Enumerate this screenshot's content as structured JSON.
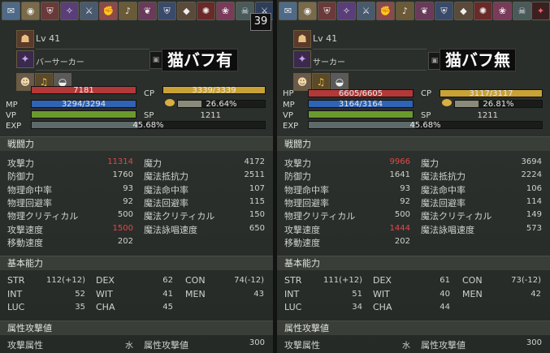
{
  "colors": {
    "hp_bar": "#b33838",
    "mp_bar": "#2e63b5",
    "vp_bar": "#6a9a2e",
    "cp_bar": "#c9a236",
    "exp_bar": "#5e6a6a",
    "highlight_red": "#e24848"
  },
  "left": {
    "buff_count": "39",
    "buffs": [
      {
        "icon": "scroll-icon",
        "glyph": "✉",
        "bg": "#4e6a88"
      },
      {
        "icon": "drum-icon",
        "glyph": "◉",
        "bg": "#7a6a4a"
      },
      {
        "icon": "shield-icon",
        "glyph": "⛨",
        "bg": "#6a3a3a"
      },
      {
        "icon": "magic-icon",
        "glyph": "✧",
        "bg": "#5a3e7a"
      },
      {
        "icon": "blade-icon",
        "glyph": "⚔",
        "bg": "#4a5a6e"
      },
      {
        "icon": "fist-icon",
        "glyph": "✊",
        "bg": "#8a4a4a"
      },
      {
        "icon": "horn-icon",
        "glyph": "♪",
        "bg": "#6a5a38"
      },
      {
        "icon": "feather-icon",
        "glyph": "❦",
        "bg": "#6a3a5a"
      },
      {
        "icon": "shield2-icon",
        "glyph": "⛨",
        "bg": "#3a4a6a"
      },
      {
        "icon": "gem-icon",
        "glyph": "◆",
        "bg": "#5a4a3a"
      },
      {
        "icon": "swirl-icon",
        "glyph": "✺",
        "bg": "#6a2a2a"
      },
      {
        "icon": "flower-icon",
        "glyph": "❀",
        "bg": "#7a3a5a"
      },
      {
        "icon": "skull-icon",
        "glyph": "☠",
        "bg": "#4a5a5a"
      },
      {
        "icon": "cross-swords-icon",
        "glyph": "⚔",
        "bg": "#2e3e5a"
      },
      {
        "icon": "flame-icon",
        "glyph": "♨",
        "bg": "#5a2020"
      }
    ],
    "level": "Lv 41",
    "class_name": "バーサーカー",
    "badge": "猫バフ有",
    "vitals": {
      "hp": "7181",
      "hp_fill": 1.0,
      "mp": "3294/3294",
      "mp_fill": 1.0,
      "vp_fill": 1.0,
      "cp": "3339/3339",
      "cp_fill": 1.0,
      "soul": "26.64%",
      "soul_fill": 0.2664,
      "sp": "1211",
      "exp": "45.68%",
      "exp_fill": 0.4568
    },
    "labels": {
      "mp": "MP",
      "vp": "VP",
      "exp": "EXP",
      "cp": "CP",
      "sp": "SP"
    },
    "section_combat": "戦闘力",
    "combat_left": [
      {
        "label": "攻撃力",
        "value": "11314",
        "red": true
      },
      {
        "label": "防御力",
        "value": "1760",
        "red": false
      },
      {
        "label": "物理命中率",
        "value": "93",
        "red": false
      },
      {
        "label": "物理回避率",
        "value": "92",
        "red": false
      },
      {
        "label": "物理クリティカル",
        "value": "500",
        "red": false
      },
      {
        "label": "攻撃速度",
        "value": "1500",
        "red": true
      },
      {
        "label": "移動速度",
        "value": "202",
        "red": false
      }
    ],
    "combat_right": [
      {
        "label": "魔力",
        "value": "4172"
      },
      {
        "label": "魔法抵抗力",
        "value": "2511"
      },
      {
        "label": "魔法命中率",
        "value": "107"
      },
      {
        "label": "魔法回避率",
        "value": "115"
      },
      {
        "label": "魔法クリティカル",
        "value": "150"
      },
      {
        "label": "魔法詠唱速度",
        "value": "650"
      }
    ],
    "section_basic": "基本能力",
    "basic": [
      [
        {
          "label": "STR",
          "value": "112(+12)"
        },
        {
          "label": "DEX",
          "value": "62"
        },
        {
          "label": "CON",
          "value": "74(-12)"
        }
      ],
      [
        {
          "label": "INT",
          "value": "52"
        },
        {
          "label": "WIT",
          "value": "41"
        },
        {
          "label": "MEN",
          "value": "43"
        }
      ],
      [
        {
          "label": "LUC",
          "value": "35"
        },
        {
          "label": "CHA",
          "value": "45"
        }
      ]
    ],
    "section_attr": "属性攻撃値",
    "attr": {
      "label1": "攻撃属性",
      "value1": "水",
      "label2": "属性攻撃値",
      "value2": "300"
    }
  },
  "right": {
    "buffs": [
      {
        "icon": "scroll-icon",
        "glyph": "✉",
        "bg": "#4e6a88"
      },
      {
        "icon": "drum-icon",
        "glyph": "◉",
        "bg": "#7a6a4a"
      },
      {
        "icon": "shield-icon",
        "glyph": "⛨",
        "bg": "#6a3a3a"
      },
      {
        "icon": "magic-icon",
        "glyph": "✧",
        "bg": "#5a3e7a"
      },
      {
        "icon": "blade-icon",
        "glyph": "⚔",
        "bg": "#4a5a6e"
      },
      {
        "icon": "fist-icon",
        "glyph": "✊",
        "bg": "#8a4a4a"
      },
      {
        "icon": "horn-icon",
        "glyph": "♪",
        "bg": "#6a5a38"
      },
      {
        "icon": "feather-icon",
        "glyph": "❦",
        "bg": "#6a3a5a"
      },
      {
        "icon": "shield2-icon",
        "glyph": "⛨",
        "bg": "#3a4a6a"
      },
      {
        "icon": "gem-icon",
        "glyph": "◆",
        "bg": "#5a4a3a"
      },
      {
        "icon": "swirl-icon",
        "glyph": "✺",
        "bg": "#6a2a2a"
      },
      {
        "icon": "flower-icon",
        "glyph": "❀",
        "bg": "#7a3a5a"
      },
      {
        "icon": "skull-icon",
        "glyph": "☠",
        "bg": "#4a5a5a"
      },
      {
        "icon": "cross-swords-icon",
        "glyph": "⚔",
        "bg": "#2e3e5a"
      },
      {
        "icon": "flame-icon",
        "glyph": "♨",
        "bg": "#5a2020"
      }
    ],
    "level": "Lv 41",
    "class_name": "サーカー",
    "badge": "猫バフ無",
    "vitals": {
      "hp": "6605/6605",
      "hp_fill": 1.0,
      "mp": "3164/3164",
      "mp_fill": 1.0,
      "vp_fill": 1.0,
      "cp": "3117/3117",
      "cp_fill": 1.0,
      "soul": "26.81%",
      "soul_fill": 0.2681,
      "sp": "1211",
      "exp": "45.68%",
      "exp_fill": 0.4568
    },
    "labels": {
      "hp": "HP",
      "mp": "MP",
      "vp": "VP",
      "exp": "EXP",
      "cp": "CP",
      "sp": "SP"
    },
    "section_combat": "戦闘力",
    "combat_left": [
      {
        "label": "攻撃力",
        "value": "9966",
        "red": true
      },
      {
        "label": "防御力",
        "value": "1641",
        "red": false
      },
      {
        "label": "物理命中率",
        "value": "93",
        "red": false
      },
      {
        "label": "物理回避率",
        "value": "92",
        "red": false
      },
      {
        "label": "物理クリティカル",
        "value": "500",
        "red": false
      },
      {
        "label": "攻撃速度",
        "value": "1444",
        "red": true
      },
      {
        "label": "移動速度",
        "value": "202",
        "red": false
      }
    ],
    "combat_right": [
      {
        "label": "魔力",
        "value": "3694"
      },
      {
        "label": "魔法抵抗力",
        "value": "2224"
      },
      {
        "label": "魔法命中率",
        "value": "106"
      },
      {
        "label": "魔法回避率",
        "value": "114"
      },
      {
        "label": "魔法クリティカル",
        "value": "149"
      },
      {
        "label": "魔法詠唱速度",
        "value": "573"
      }
    ],
    "section_basic": "基本能力",
    "basic": [
      [
        {
          "label": "STR",
          "value": "111(+12)"
        },
        {
          "label": "DEX",
          "value": "61"
        },
        {
          "label": "CON",
          "value": "73(-12)"
        }
      ],
      [
        {
          "label": "INT",
          "value": "51"
        },
        {
          "label": "WIT",
          "value": "40"
        },
        {
          "label": "MEN",
          "value": "42"
        }
      ],
      [
        {
          "label": "LUC",
          "value": "34"
        },
        {
          "label": "CHA",
          "value": "44"
        }
      ]
    ],
    "section_attr": "属性攻撃値",
    "attr": {
      "label1": "攻撃属性",
      "value1": "水",
      "label2": "属性攻撃値",
      "value2": "300"
    }
  }
}
